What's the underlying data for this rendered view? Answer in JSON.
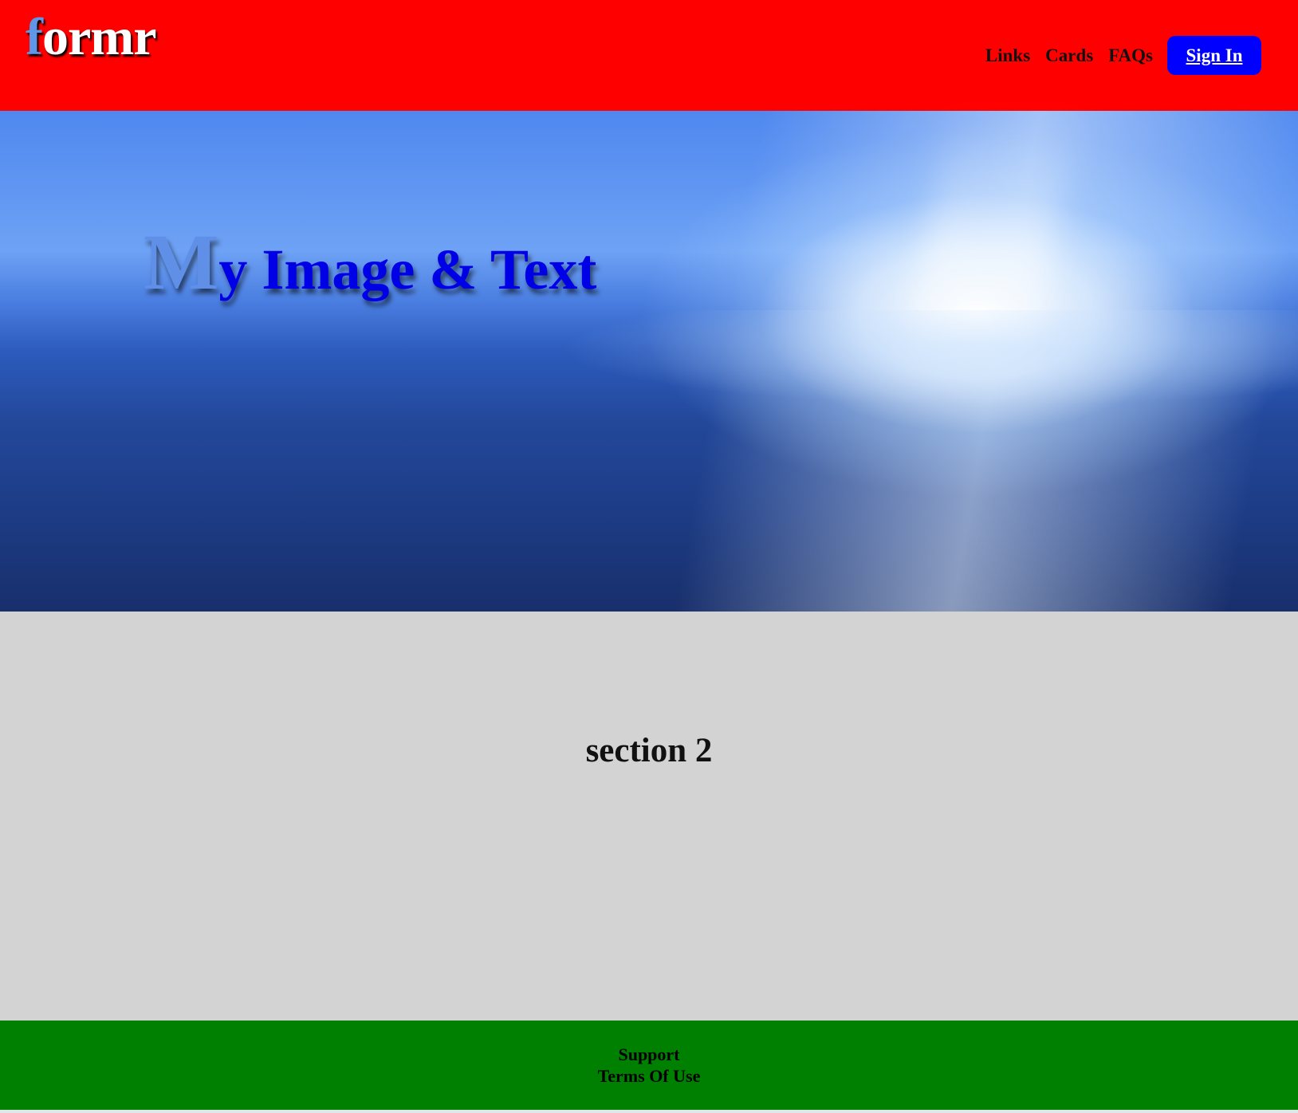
{
  "header": {
    "logo": {
      "first_letter": "f",
      "rest": "ormr"
    },
    "nav": {
      "links": [
        "Links",
        "Cards",
        "FAQs"
      ],
      "sign_in": "Sign In"
    },
    "colors": {
      "background": "#ff0000",
      "sign_in_button": "#0000ff"
    }
  },
  "hero": {
    "title_first": "M",
    "title_rest": "y Image & Text"
  },
  "section2": {
    "title": "section 2"
  },
  "footer": {
    "links": [
      "Support",
      "Terms Of Use"
    ],
    "colors": {
      "background": "#008000"
    }
  }
}
